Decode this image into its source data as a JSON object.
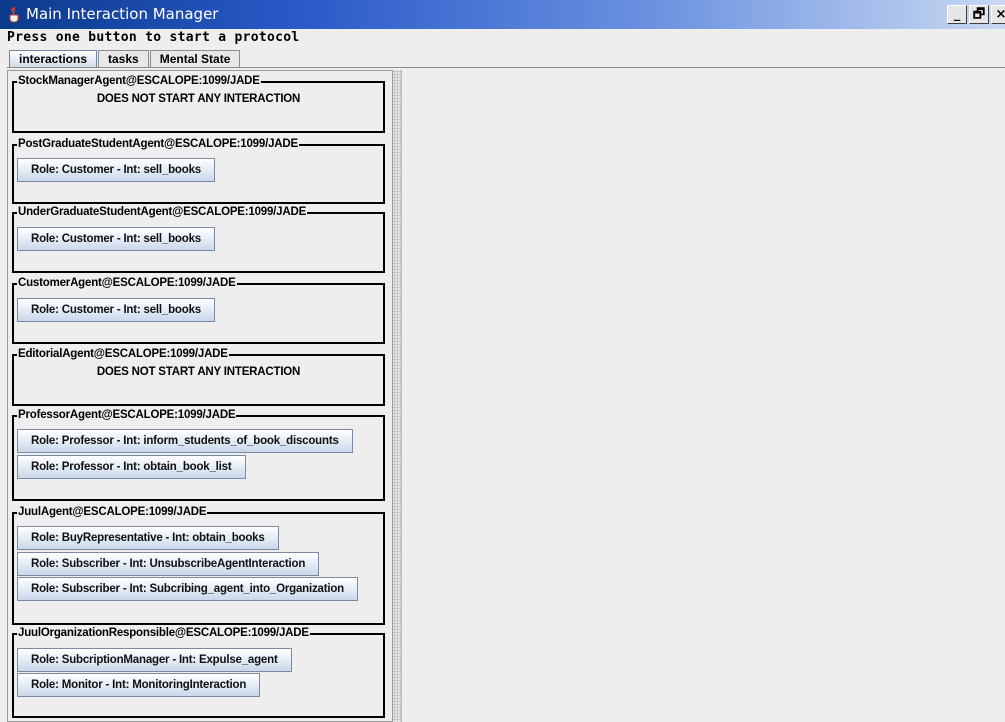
{
  "window": {
    "title": "Main Interaction Manager",
    "minimize_glyph": "_",
    "restore_glyph": "🗗",
    "close_glyph": "×"
  },
  "instructions": "Press one button to start a protocol",
  "tabs": [
    {
      "label": "interactions",
      "active": true
    },
    {
      "label": "tasks",
      "active": false
    },
    {
      "label": "Mental State",
      "active": false
    }
  ],
  "agents": [
    {
      "name": "StockManagerAgent@ESCALOPE:1099/JADE",
      "no_interaction": "DOES NOT START ANY INTERACTION",
      "buttons": []
    },
    {
      "name": "PostGraduateStudentAgent@ESCALOPE:1099/JADE",
      "buttons": [
        "Role: Customer - Int: sell_books"
      ]
    },
    {
      "name": "UnderGraduateStudentAgent@ESCALOPE:1099/JADE",
      "buttons": [
        "Role: Customer - Int: sell_books"
      ]
    },
    {
      "name": "CustomerAgent@ESCALOPE:1099/JADE",
      "buttons": [
        "Role: Customer - Int: sell_books"
      ]
    },
    {
      "name": "EditorialAgent@ESCALOPE:1099/JADE",
      "no_interaction": "DOES NOT START ANY INTERACTION",
      "buttons": []
    },
    {
      "name": "ProfessorAgent@ESCALOPE:1099/JADE",
      "buttons": [
        "Role: Professor - Int: inform_students_of_book_discounts",
        "Role: Professor - Int: obtain_book_list"
      ]
    },
    {
      "name": "JuulAgent@ESCALOPE:1099/JADE",
      "buttons": [
        "Role: BuyRepresentative - Int: obtain_books",
        "Role: Subscriber - Int: UnsubscribeAgentInteraction",
        "Role: Subscriber - Int: Subcribing_agent_into_Organization"
      ]
    },
    {
      "name": "JuulOrganizationResponsible@ESCALOPE:1099/JADE",
      "buttons": [
        "Role: SubcriptionManager - Int: Expulse_agent",
        "Role: Monitor - Int: MonitoringInteraction"
      ]
    }
  ]
}
